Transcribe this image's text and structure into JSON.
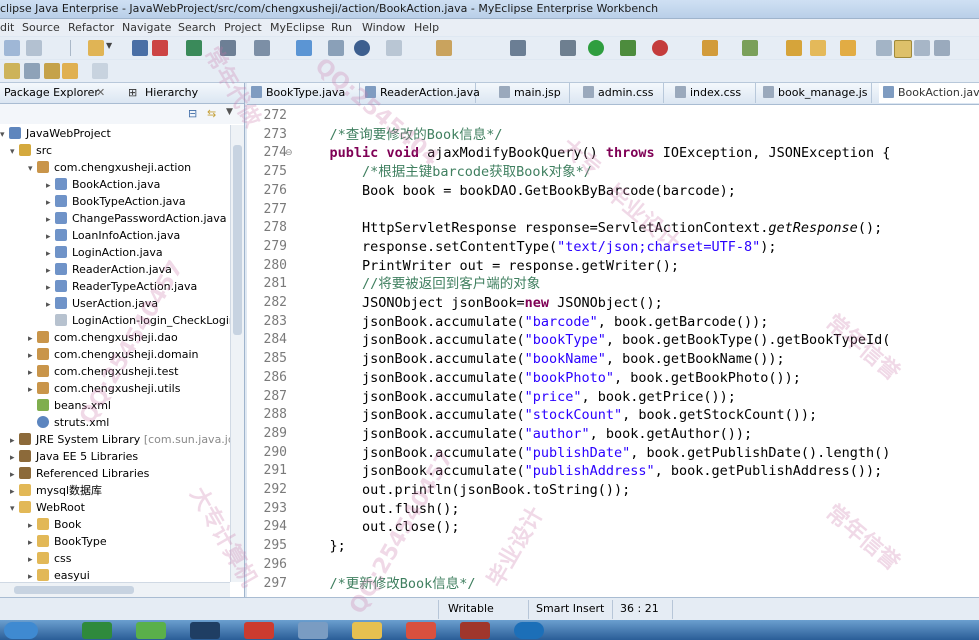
{
  "window": {
    "title": "clipse Java Enterprise - JavaWebProject/src/com/chengxusheji/action/BookAction.java - MyEclipse Enterprise Workbench"
  },
  "menu": [
    "dit",
    "Source",
    "Refactor",
    "Navigate",
    "Search",
    "Project",
    "MyEclipse",
    "Run",
    "Window",
    "Help"
  ],
  "left_panel": {
    "tabs": [
      {
        "label": "Package Explorer"
      },
      {
        "label": "Hierarchy"
      }
    ],
    "tree": [
      {
        "label": "JavaWebProject"
      },
      {
        "label": "src"
      },
      {
        "label": "com.chengxusheji.action"
      },
      {
        "label": "BookAction.java"
      },
      {
        "label": "BookTypeAction.java"
      },
      {
        "label": "ChangePasswordAction.java"
      },
      {
        "label": "LoanInfoAction.java"
      },
      {
        "label": "LoginAction.java"
      },
      {
        "label": "ReaderAction.java"
      },
      {
        "label": "ReaderTypeAction.java"
      },
      {
        "label": "UserAction.java"
      },
      {
        "label": "LoginAction-login_CheckLogin-v"
      },
      {
        "label": "com.chengxusheji.dao"
      },
      {
        "label": "com.chengxusheji.domain"
      },
      {
        "label": "com.chengxusheji.test"
      },
      {
        "label": "com.chengxusheji.utils"
      },
      {
        "label": "beans.xml"
      },
      {
        "label": "struts.xml"
      },
      {
        "label": "JRE System Library",
        "suffix": "[com.sun.java.jdk.w"
      },
      {
        "label": "Java EE 5 Libraries"
      },
      {
        "label": "Referenced Libraries"
      },
      {
        "label": "mysql数据库"
      },
      {
        "label": "WebRoot"
      },
      {
        "label": "Book"
      },
      {
        "label": "BookType"
      },
      {
        "label": "css"
      },
      {
        "label": "easyui"
      }
    ]
  },
  "editor": {
    "tabs": [
      {
        "label": "BookType.java"
      },
      {
        "label": "ReaderAction.java"
      },
      {
        "label": "main.jsp"
      },
      {
        "label": "admin.css"
      },
      {
        "label": "index.css"
      },
      {
        "label": "book_manage.js"
      },
      {
        "label": "BookAction.java"
      }
    ],
    "lines": [
      {
        "n": "272",
        "t": ""
      },
      {
        "n": "273",
        "t": "    /*查询要修改的Book信息*/"
      },
      {
        "n": "274",
        "t": "    public void ajaxModifyBookQuery() throws IOException, JSONException {"
      },
      {
        "n": "275",
        "t": "        /*根据主键barcode获取Book对象*/"
      },
      {
        "n": "276",
        "t": "        Book book = bookDAO.GetBookByBarcode(barcode);"
      },
      {
        "n": "277",
        "t": ""
      },
      {
        "n": "278",
        "t": "        HttpServletResponse response=ServletActionContext.getResponse();"
      },
      {
        "n": "279",
        "t": "        response.setContentType(\"text/json;charset=UTF-8\");"
      },
      {
        "n": "280",
        "t": "        PrintWriter out = response.getWriter();"
      },
      {
        "n": "281",
        "t": "        //将要被返回到客户端的对象"
      },
      {
        "n": "282",
        "t": "        JSONObject jsonBook=new JSONObject();"
      },
      {
        "n": "283",
        "t": "        jsonBook.accumulate(\"barcode\", book.getBarcode());"
      },
      {
        "n": "284",
        "t": "        jsonBook.accumulate(\"bookType\", book.getBookType().getBookTypeId("
      },
      {
        "n": "285",
        "t": "        jsonBook.accumulate(\"bookName\", book.getBookName());"
      },
      {
        "n": "286",
        "t": "        jsonBook.accumulate(\"bookPhoto\", book.getBookPhoto());"
      },
      {
        "n": "287",
        "t": "        jsonBook.accumulate(\"price\", book.getPrice());"
      },
      {
        "n": "288",
        "t": "        jsonBook.accumulate(\"stockCount\", book.getStockCount());"
      },
      {
        "n": "289",
        "t": "        jsonBook.accumulate(\"author\", book.getAuthor());"
      },
      {
        "n": "290",
        "t": "        jsonBook.accumulate(\"publishDate\", book.getPublishDate().length()"
      },
      {
        "n": "291",
        "t": "        jsonBook.accumulate(\"publishAddress\", book.getPublishAddress());"
      },
      {
        "n": "292",
        "t": "        out.println(jsonBook.toString());"
      },
      {
        "n": "293",
        "t": "        out.flush();"
      },
      {
        "n": "294",
        "t": "        out.close();"
      },
      {
        "n": "295",
        "t": "    };"
      },
      {
        "n": "296",
        "t": ""
      },
      {
        "n": "297",
        "t": "    /*更新修改Book信息*/"
      }
    ]
  },
  "status": {
    "writable": "Writable",
    "insert_mode": "Smart Insert",
    "position": "36 : 21"
  },
  "watermarks": [
    "QQ:2545404",
    "常年代做",
    "大专",
    "毕业设计",
    "QQ:254540457",
    "常年信誉",
    "大专计算机",
    "QQ:254540457",
    "毕业设计",
    "常年信誉"
  ],
  "colors": {
    "keyword": "#7f0055",
    "string": "#2a00ff",
    "comment": "#3f7f5f",
    "chrome": "#dfe8f2"
  }
}
